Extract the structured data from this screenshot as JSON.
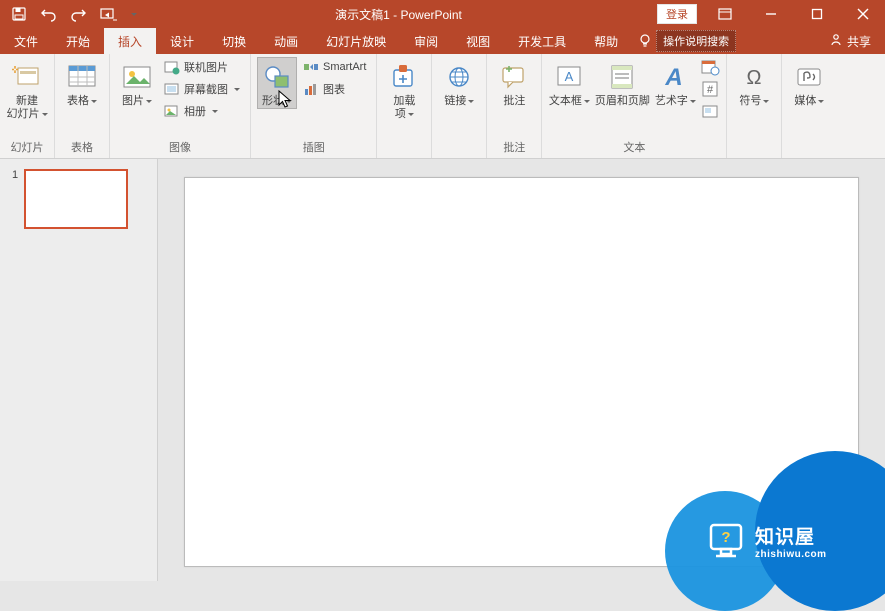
{
  "title": "演示文稿1 - PowerPoint",
  "login": "登录",
  "share": "共享",
  "tellme_placeholder": "操作说明搜索",
  "tabs": {
    "file": "文件",
    "home": "开始",
    "insert": "插入",
    "design": "设计",
    "transitions": "切换",
    "animations": "动画",
    "slideshow": "幻灯片放映",
    "review": "审阅",
    "view": "视图",
    "developer": "开发工具",
    "help": "帮助"
  },
  "ribbon": {
    "slides": {
      "new_slide": "新建\n幻灯片",
      "group": "幻灯片"
    },
    "tables": {
      "table": "表格",
      "group": "表格"
    },
    "images": {
      "pictures": "图片",
      "online": "联机图片",
      "screenshot": "屏幕截图",
      "album": "相册",
      "group": "图像"
    },
    "illustrations": {
      "shapes": "形状",
      "smartart": "SmartArt",
      "chart": "图表",
      "group": "插图"
    },
    "addins": {
      "addins": "加载\n项",
      "group": ""
    },
    "links": {
      "link": "链接",
      "group": ""
    },
    "comments": {
      "comment": "批注",
      "group": "批注"
    },
    "text": {
      "textbox": "文本框",
      "header": "页眉和页脚",
      "wordart": "艺术字",
      "group": "文本"
    },
    "symbols": {
      "symbol": "符号",
      "group": ""
    },
    "media": {
      "media": "媒体",
      "group": ""
    }
  },
  "slide_number": "1",
  "watermark": {
    "cn": "知识屋",
    "url": "zhishiwu.com"
  }
}
